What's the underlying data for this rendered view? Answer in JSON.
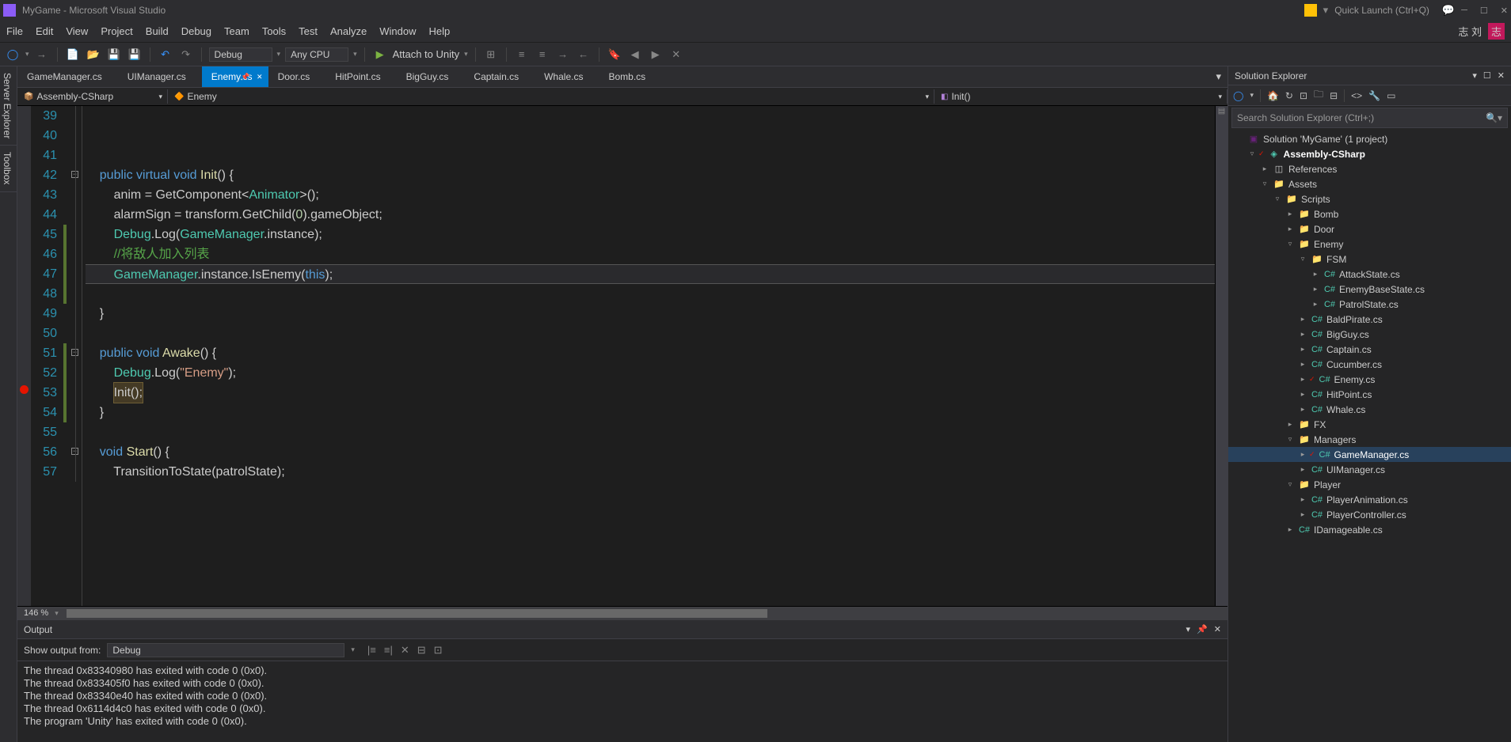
{
  "title": "MyGame - Microsoft Visual Studio",
  "quick_launch": "Quick Launch (Ctrl+Q)",
  "user_name": "志 刘",
  "user_badge": "志",
  "menu": [
    "File",
    "Edit",
    "View",
    "Project",
    "Build",
    "Debug",
    "Team",
    "Tools",
    "Test",
    "Analyze",
    "Window",
    "Help"
  ],
  "toolbar": {
    "config": "Debug",
    "platform": "Any CPU",
    "attach": "Attach to Unity"
  },
  "side_tabs": [
    "Server Explorer",
    "Toolbox"
  ],
  "tabs": [
    {
      "label": "GameManager.cs",
      "active": false
    },
    {
      "label": "UIManager.cs",
      "active": false
    },
    {
      "label": "Enemy.cs",
      "active": true
    },
    {
      "label": "Door.cs",
      "active": false
    },
    {
      "label": "HitPoint.cs",
      "active": false
    },
    {
      "label": "BigGuy.cs",
      "active": false
    },
    {
      "label": "Captain.cs",
      "active": false
    },
    {
      "label": "Whale.cs",
      "active": false
    },
    {
      "label": "Bomb.cs",
      "active": false
    }
  ],
  "nav": {
    "project": "Assembly-CSharp",
    "class": "Enemy",
    "member": "Init()"
  },
  "zoom": "146 %",
  "code_lines": [
    {
      "n": 39,
      "html": ""
    },
    {
      "n": 40,
      "html": ""
    },
    {
      "n": 41,
      "html": ""
    },
    {
      "n": 42,
      "fold": "-",
      "html": "    <span class=kw>public</span> <span class=kw>virtual</span> <span class=kw>void</span> <span class=method>Init</span>() {"
    },
    {
      "n": 43,
      "html": "        anim = GetComponent&lt;<span class=type>Animator</span>&gt;();"
    },
    {
      "n": 44,
      "html": "        alarmSign = transform.GetChild(<span class=num>0</span>).gameObject;"
    },
    {
      "n": 45,
      "mod": true,
      "html": "        <span class=type>Debug</span>.Log(<span class=type>GameManager</span>.instance);"
    },
    {
      "n": 46,
      "mod": true,
      "html": "        <span class=cmt>//将敌人加入列表</span>"
    },
    {
      "n": 47,
      "mod": true,
      "hl": true,
      "html": "        <span class=type>GameManager</span>.instance.IsEnemy(<span class=kw>this</span>);"
    },
    {
      "n": 48,
      "mod": true,
      "html": ""
    },
    {
      "n": 49,
      "html": "    }"
    },
    {
      "n": 50,
      "html": ""
    },
    {
      "n": 51,
      "mod": true,
      "fold": "-",
      "html": "    <span class=kw>public</span> <span class=kw>void</span> <span class=method>Awake</span>() {"
    },
    {
      "n": 52,
      "mod": true,
      "html": "        <span class=type>Debug</span>.Log(<span class=str>\"Enemy\"</span>);"
    },
    {
      "n": 53,
      "mod": true,
      "bp": true,
      "html": "        <span class=call-hl>Init();</span>"
    },
    {
      "n": 54,
      "mod": true,
      "html": "    }"
    },
    {
      "n": 55,
      "html": ""
    },
    {
      "n": 56,
      "fold": "-",
      "html": "    <span class=kw>void</span> <span class=method>Start</span>() {"
    },
    {
      "n": 57,
      "html": "        TransitionToState(patrolState);"
    }
  ],
  "output": {
    "title": "Output",
    "from_label": "Show output from:",
    "from_value": "Debug",
    "lines": [
      "The thread 0x83340980 has exited with code 0 (0x0).",
      "The thread 0x833405f0 has exited with code 0 (0x0).",
      "The thread 0x83340e40 has exited with code 0 (0x0).",
      "The thread 0x6114d4c0 has exited with code 0 (0x0).",
      "The program 'Unity' has exited with code 0 (0x0)."
    ]
  },
  "explorer": {
    "title": "Solution Explorer",
    "search": "Search Solution Explorer (Ctrl+;)",
    "tree": [
      {
        "d": 0,
        "a": "",
        "i": "sln",
        "t": "Solution 'MyGame' (1 project)"
      },
      {
        "d": 1,
        "a": "▿",
        "i": "proj",
        "t": "Assembly-CSharp",
        "bold": true,
        "dirty": true
      },
      {
        "d": 2,
        "a": "▸",
        "i": "ref",
        "t": "References"
      },
      {
        "d": 2,
        "a": "▿",
        "i": "folder",
        "t": "Assets"
      },
      {
        "d": 3,
        "a": "▿",
        "i": "folder",
        "t": "Scripts"
      },
      {
        "d": 4,
        "a": "▸",
        "i": "folder",
        "t": "Bomb"
      },
      {
        "d": 4,
        "a": "▸",
        "i": "folder",
        "t": "Door"
      },
      {
        "d": 4,
        "a": "▿",
        "i": "folder",
        "t": "Enemy"
      },
      {
        "d": 5,
        "a": "▿",
        "i": "folder",
        "t": "FSM"
      },
      {
        "d": 6,
        "a": "▸",
        "i": "cs",
        "t": "AttackState.cs"
      },
      {
        "d": 6,
        "a": "▸",
        "i": "cs",
        "t": "EnemyBaseState.cs"
      },
      {
        "d": 6,
        "a": "▸",
        "i": "cs",
        "t": "PatrolState.cs"
      },
      {
        "d": 5,
        "a": "▸",
        "i": "cs",
        "t": "BaldPirate.cs"
      },
      {
        "d": 5,
        "a": "▸",
        "i": "cs",
        "t": "BigGuy.cs"
      },
      {
        "d": 5,
        "a": "▸",
        "i": "cs",
        "t": "Captain.cs"
      },
      {
        "d": 5,
        "a": "▸",
        "i": "cs",
        "t": "Cucumber.cs"
      },
      {
        "d": 5,
        "a": "▸",
        "i": "cs",
        "t": "Enemy.cs",
        "dirty": true
      },
      {
        "d": 5,
        "a": "▸",
        "i": "cs",
        "t": "HitPoint.cs"
      },
      {
        "d": 5,
        "a": "▸",
        "i": "cs",
        "t": "Whale.cs"
      },
      {
        "d": 4,
        "a": "▸",
        "i": "folder",
        "t": "FX"
      },
      {
        "d": 4,
        "a": "▿",
        "i": "folder",
        "t": "Managers"
      },
      {
        "d": 5,
        "a": "▸",
        "i": "cs",
        "t": "GameManager.cs",
        "dirty": true,
        "selected": true
      },
      {
        "d": 5,
        "a": "▸",
        "i": "cs",
        "t": "UIManager.cs"
      },
      {
        "d": 4,
        "a": "▿",
        "i": "folder",
        "t": "Player"
      },
      {
        "d": 5,
        "a": "▸",
        "i": "cs",
        "t": "PlayerAnimation.cs"
      },
      {
        "d": 5,
        "a": "▸",
        "i": "cs",
        "t": "PlayerController.cs"
      },
      {
        "d": 4,
        "a": "▸",
        "i": "cs",
        "t": "IDamageable.cs"
      }
    ]
  }
}
